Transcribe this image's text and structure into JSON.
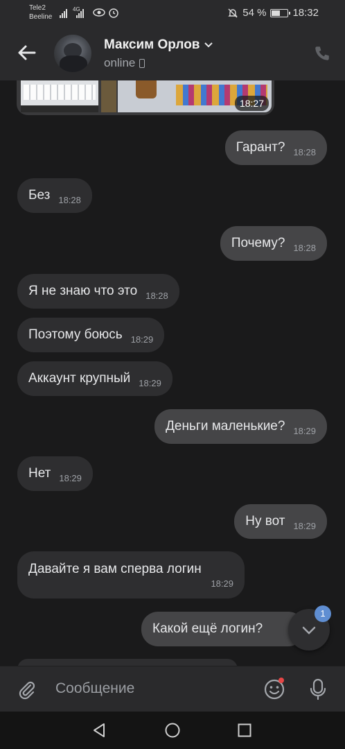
{
  "status_bar": {
    "carrier1": "Tele2",
    "carrier2": "Beeline",
    "network": "4G",
    "battery_percent": "54 %",
    "battery_level": 0.54,
    "time": "18:32"
  },
  "header": {
    "contact_name": "Максим Орлов",
    "status": "online"
  },
  "media_message": {
    "time": "18:27"
  },
  "messages": [
    {
      "text": "Гарант?",
      "time": "18:28",
      "direction": "out"
    },
    {
      "text": "Без",
      "time": "18:28",
      "direction": "in"
    },
    {
      "text": "Почему?",
      "time": "18:28",
      "direction": "out"
    },
    {
      "text": "Я не знаю что это",
      "time": "18:28",
      "direction": "in"
    },
    {
      "text": "Поэтому боюсь",
      "time": "18:29",
      "direction": "in"
    },
    {
      "text": "Аккаунт крупный",
      "time": "18:29",
      "direction": "in"
    },
    {
      "text": "Деньги маленькие?",
      "time": "18:29",
      "direction": "out"
    },
    {
      "text": "Нет",
      "time": "18:29",
      "direction": "in"
    },
    {
      "text": "Ну вот",
      "time": "18:29",
      "direction": "out"
    },
    {
      "text": "Давайте я вам сперва логин",
      "time": "18:29",
      "direction": "in"
    },
    {
      "text": "Какой ещё логин?",
      "time": "",
      "direction": "out"
    }
  ],
  "scroll_down": {
    "unread_count": "1"
  },
  "composer": {
    "placeholder": "Сообщение"
  },
  "icons": {
    "back": "arrow-left-icon",
    "call": "phone-icon",
    "attach": "paperclip-icon",
    "emoji": "smile-icon",
    "mic": "microphone-icon",
    "scroll": "chevron-down-icon"
  },
  "colors": {
    "background": "#1a1a1b",
    "incoming_bubble": "#2e2e30",
    "outgoing_bubble": "#454547",
    "badge": "#5f8ed2"
  }
}
